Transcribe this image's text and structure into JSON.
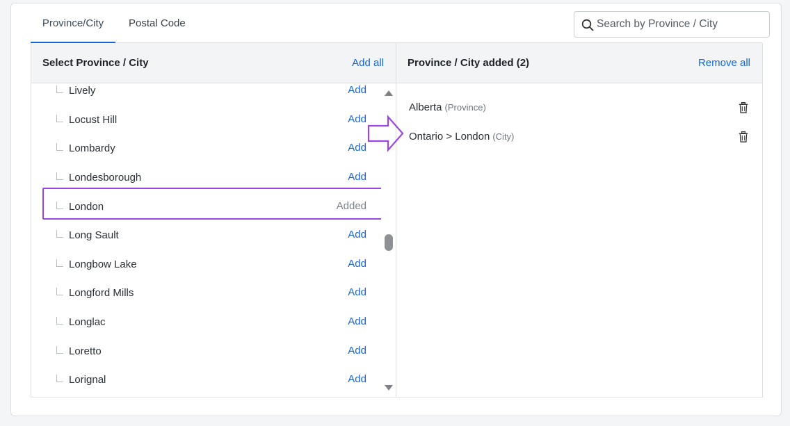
{
  "tabs": [
    {
      "label": "Province/City",
      "active": true
    },
    {
      "label": "Postal Code",
      "active": false
    }
  ],
  "search": {
    "placeholder": "Search by Province / City"
  },
  "left_panel": {
    "title": "Select Province / City",
    "action": "Add all",
    "items": [
      {
        "name": "Lively",
        "action": "Add"
      },
      {
        "name": "Locust Hill",
        "action": "Add"
      },
      {
        "name": "Lombardy",
        "action": "Add"
      },
      {
        "name": "Londesborough",
        "action": "Add"
      },
      {
        "name": "London",
        "action": "Added"
      },
      {
        "name": "Long Sault",
        "action": "Add"
      },
      {
        "name": "Longbow Lake",
        "action": "Add"
      },
      {
        "name": "Longford Mills",
        "action": "Add"
      },
      {
        "name": "Longlac",
        "action": "Add"
      },
      {
        "name": "Loretto",
        "action": "Add"
      },
      {
        "name": "Lorignal",
        "action": "Add"
      }
    ]
  },
  "right_panel": {
    "title": "Province / City added (2)",
    "action": "Remove all",
    "items": [
      {
        "label": "Alberta",
        "type": "(Province)"
      },
      {
        "label": "Ontario > London",
        "type": "(City)"
      }
    ]
  },
  "colors": {
    "accent": "#1565d8",
    "highlight": "#9b45e4"
  },
  "icons": [
    "search-icon",
    "trash-icon",
    "scroll-up-icon",
    "scroll-down-icon",
    "arrow-right-icon"
  ]
}
